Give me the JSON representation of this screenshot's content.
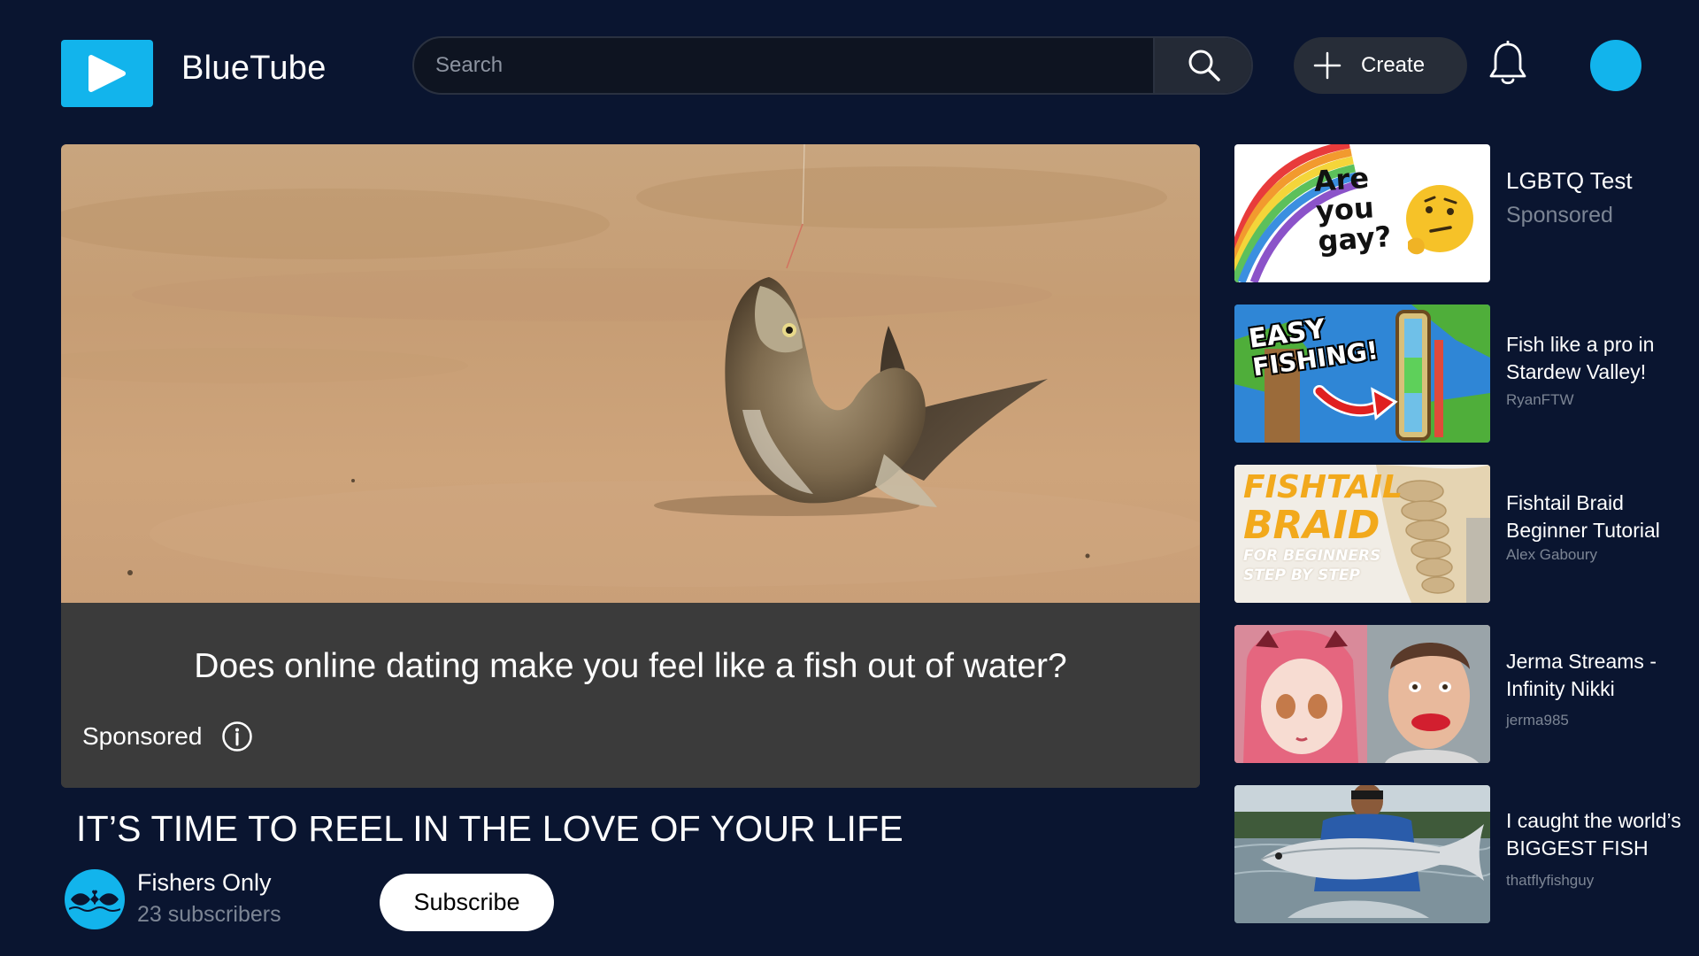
{
  "header": {
    "app_name": "BlueTube",
    "search_placeholder": "Search",
    "create_label": "Create"
  },
  "player": {
    "ad_caption": "Does online dating make you feel like a fish out of water?",
    "sponsored_label": "Sponsored"
  },
  "video": {
    "title": "IT’S TIME TO REEL IN THE LOVE OF YOUR LIFE",
    "channel_name": "Fishers Only",
    "channel_subscribers": "23 subscribers",
    "subscribe_label": "Subscribe"
  },
  "recommendations": [
    {
      "title": "LGBTQ Test",
      "meta": "Sponsored",
      "thumb_text": [
        "Are",
        "you",
        "gay?"
      ]
    },
    {
      "title": "Fish like a pro in Stardew Valley!",
      "meta": "RyanFTW",
      "thumb_text": [
        "EASY",
        "FISHING!"
      ]
    },
    {
      "title": "Fishtail Braid Beginner Tutorial",
      "meta": "Alex Gaboury",
      "thumb_text": [
        "FISHTAIL",
        "BRAID",
        "FOR BEGINNERS",
        "STEP BY STEP"
      ]
    },
    {
      "title": "Jerma Streams - Infinity Nikki",
      "meta": "jerma985"
    },
    {
      "title": "I caught the world’s BIGGEST FISH",
      "meta": "thatflyfishguy"
    }
  ],
  "colors": {
    "background": "#0a1530",
    "accent": "#12b4ec",
    "muted_text": "#7c8594"
  }
}
